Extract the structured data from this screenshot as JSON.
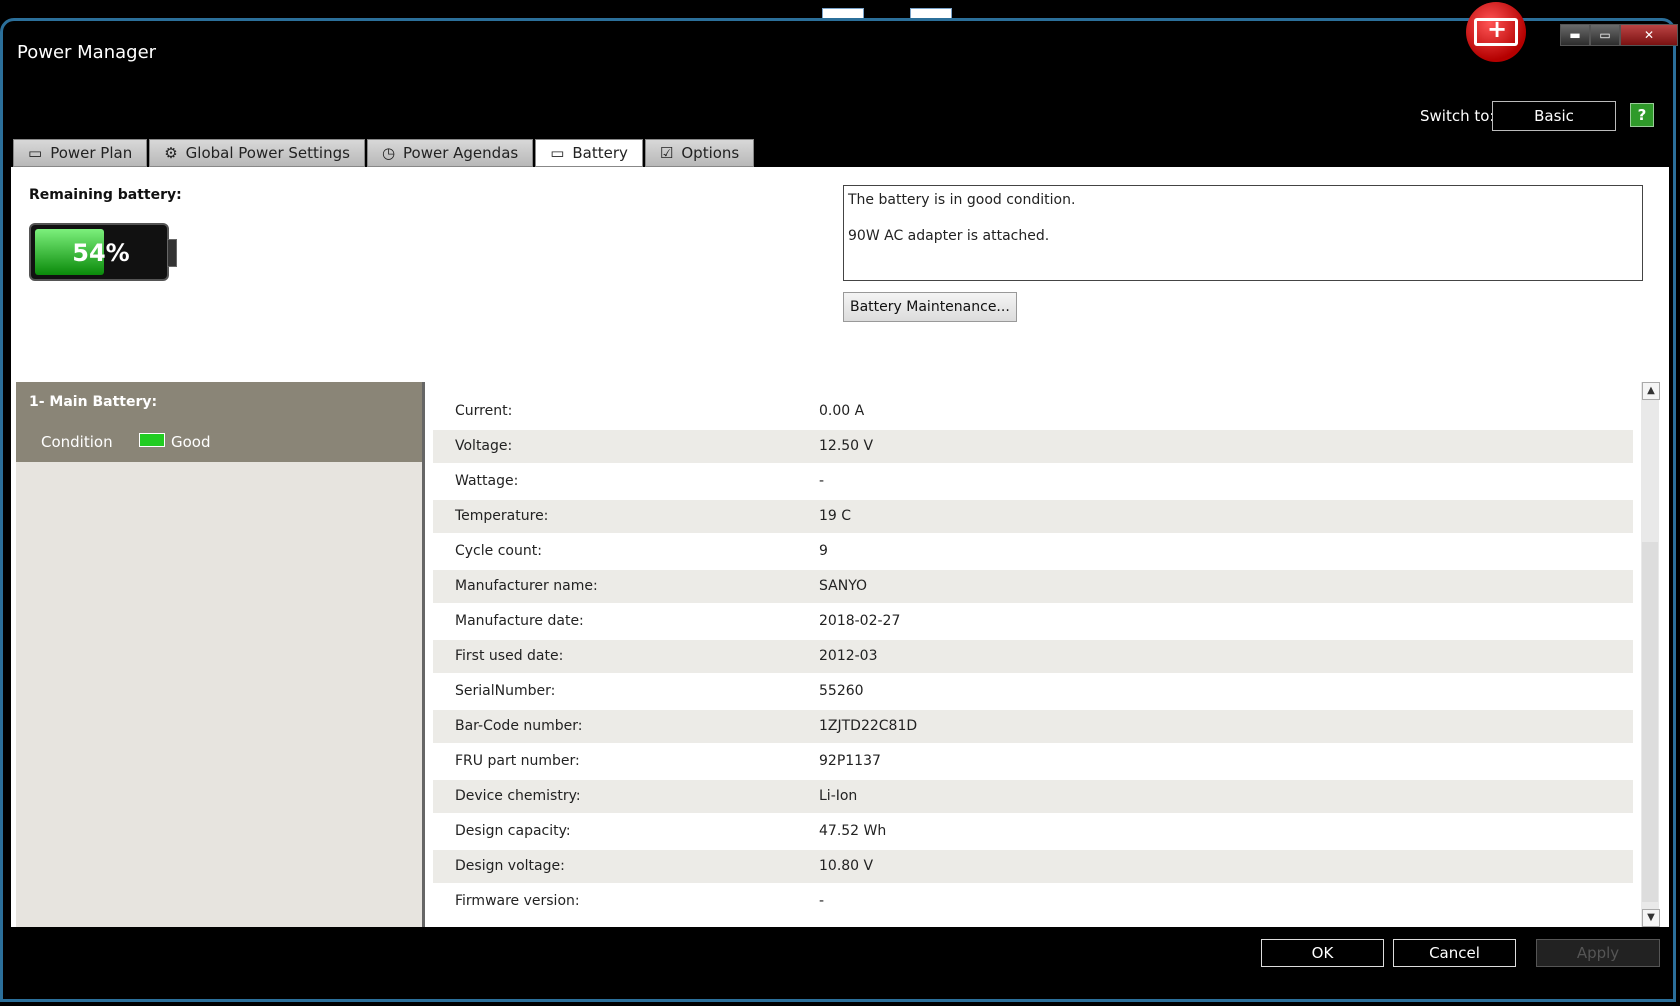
{
  "window": {
    "title": "Power Manager"
  },
  "header": {
    "switch_label": "Switch to:",
    "switch_button": "Basic",
    "help_icon": "?"
  },
  "tabs": [
    {
      "label": "Power Plan",
      "icon": "battery-outline-icon"
    },
    {
      "label": "Global Power Settings",
      "icon": "gear-icon"
    },
    {
      "label": "Power Agendas",
      "icon": "clock-icon"
    },
    {
      "label": "Battery",
      "icon": "battery-outline-icon"
    },
    {
      "label": "Options",
      "icon": "checkbox-icon"
    }
  ],
  "battery": {
    "remaining_label": "Remaining battery:",
    "percent_text": "54%",
    "level": 0.54,
    "status_line1": "The battery is in good condition.",
    "status_line2": "90W AC adapter is attached.",
    "maintenance_button": "Battery Maintenance..."
  },
  "left_panel": {
    "title": "1- Main Battery:",
    "condition_label": "Condition",
    "condition_value": "Good"
  },
  "details": [
    {
      "key": "Current:",
      "value": "0.00 A"
    },
    {
      "key": "Voltage:",
      "value": "12.50 V"
    },
    {
      "key": "Wattage:",
      "value": "-"
    },
    {
      "key": "Temperature:",
      "value": "19 C"
    },
    {
      "key": "Cycle count:",
      "value": "9"
    },
    {
      "key": "Manufacturer name:",
      "value": "SANYO"
    },
    {
      "key": "Manufacture date:",
      "value": "2018-02-27"
    },
    {
      "key": "First used date:",
      "value": "2012-03"
    },
    {
      "key": "SerialNumber:",
      "value": "55260"
    },
    {
      "key": "Bar-Code number:",
      "value": "1ZJTD22C81D"
    },
    {
      "key": "FRU part number:",
      "value": "92P1137"
    },
    {
      "key": "Device chemistry:",
      "value": "Li-Ion"
    },
    {
      "key": "Design capacity:",
      "value": "47.52 Wh"
    },
    {
      "key": "Design voltage:",
      "value": "10.80 V"
    },
    {
      "key": "Firmware version:",
      "value": "-"
    }
  ],
  "footer": {
    "ok": "OK",
    "cancel": "Cancel",
    "apply": "Apply"
  }
}
